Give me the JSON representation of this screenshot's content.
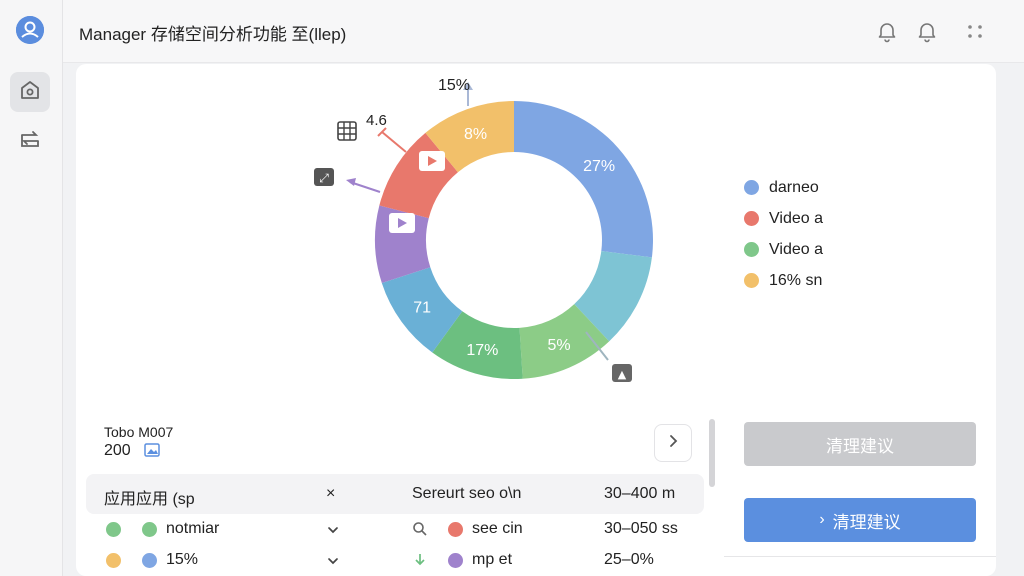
{
  "header": {
    "title": "Manager 存储空间分析功能 至(llep)"
  },
  "sidebar": {
    "items": [
      {
        "name": "home",
        "icon": "home-icon",
        "active": true
      },
      {
        "name": "transfer",
        "icon": "transfer-icon",
        "active": false
      }
    ]
  },
  "chart_data": {
    "type": "pie",
    "donut": true,
    "slices": [
      {
        "label": "27%",
        "value": 27,
        "color": "#7fa6e3"
      },
      {
        "label": "",
        "value": 11,
        "color": "#7ec4d4"
      },
      {
        "label": "5%",
        "value": 11,
        "color": "#8ccc87"
      },
      {
        "label": "17%",
        "value": 11,
        "color": "#6cbf80"
      },
      {
        "label": "71",
        "value": 10,
        "color": "#6ab0d6"
      },
      {
        "label": "",
        "value": 9,
        "color": "#9f82cc"
      },
      {
        "label": "",
        "value": 10,
        "color": "#e8786c"
      },
      {
        "label": "8%",
        "value": 11,
        "color": "#f2c06a"
      }
    ],
    "annotations": [
      {
        "text": "15%"
      },
      {
        "text": "4.6"
      }
    ],
    "legend": [
      {
        "label": "darneo",
        "color": "#7fa6e3"
      },
      {
        "label": "Video a",
        "color": "#e8786c"
      },
      {
        "label": "Video a",
        "color": "#7fc78a"
      },
      {
        "label": "16% sn",
        "color": "#f2c06a"
      }
    ]
  },
  "summary": {
    "label": "Tobo M007",
    "value": "200"
  },
  "table": {
    "header": {
      "col1": "应用应用 (sp",
      "col2": "×",
      "col3": "Sereurt seo o\\n",
      "col4": "30–400 m"
    },
    "rows": [
      {
        "dot1": "#7fc78a",
        "dot2": "#7fc78a",
        "name": "notmiar",
        "dot3": "#e8786c",
        "label": "see cin",
        "value": "30–050 ss"
      },
      {
        "dot1": "#f2c06a",
        "dot2": "#7fa6e3",
        "name": "15%",
        "dot3": "#9f82cc",
        "label": "mp et",
        "value": "25–0%"
      }
    ]
  },
  "panel": {
    "btn_grey": "清理建议",
    "btn_blue": "清理建议"
  }
}
